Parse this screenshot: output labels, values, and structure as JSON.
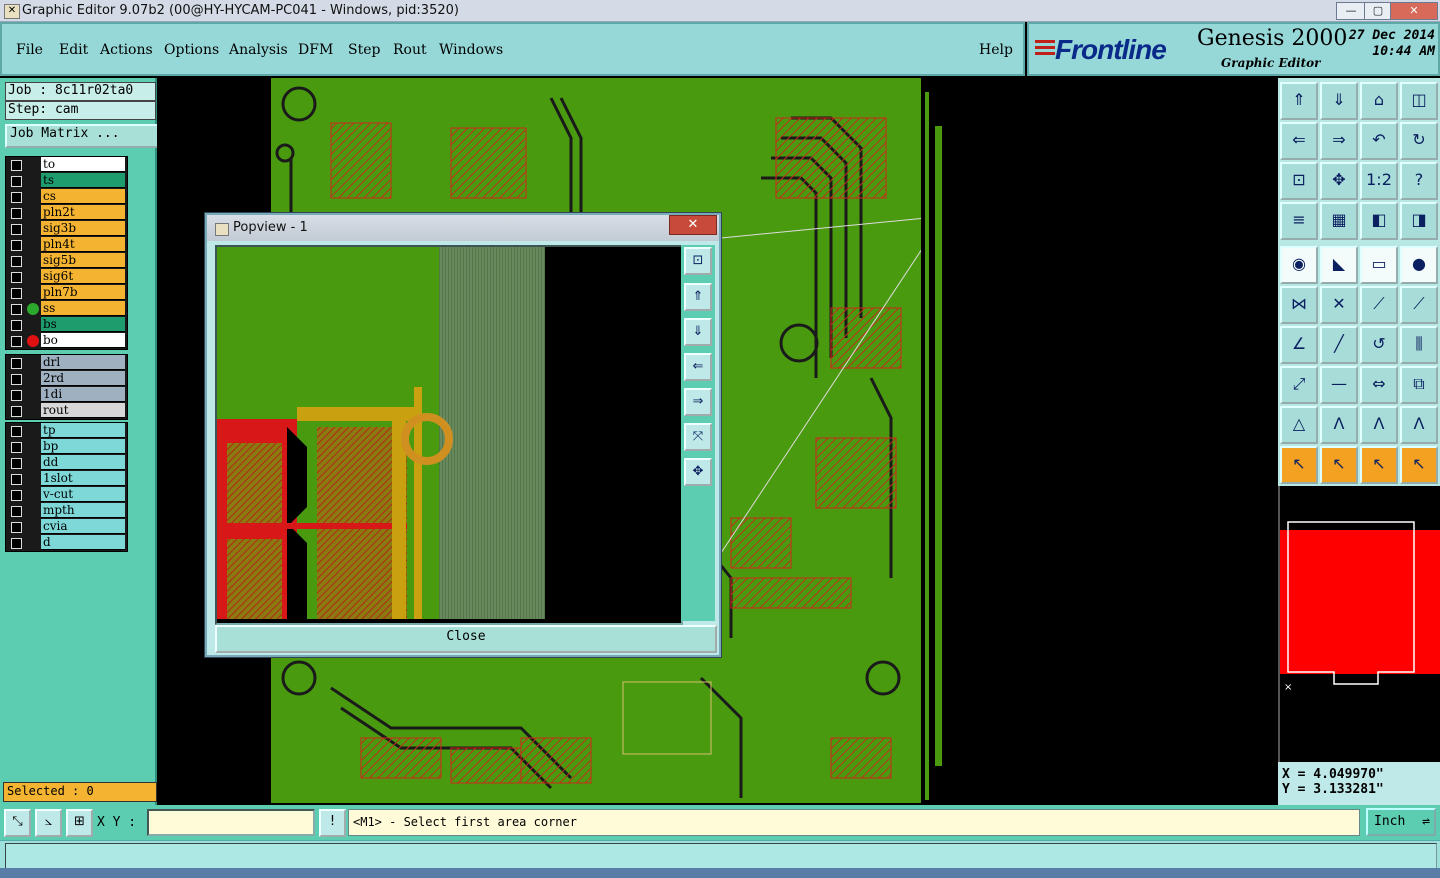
{
  "window": {
    "title": "Graphic Editor 9.07b2 (00@HY-HYCAM-PC041 - Windows, pid:3520)",
    "controls": [
      "—",
      "▢",
      "✕"
    ]
  },
  "menu": {
    "items": [
      "File",
      "Edit",
      "Actions",
      "Options",
      "Analysis",
      "DFM",
      "Step",
      "Rout",
      "Windows"
    ],
    "help": "Help"
  },
  "logo": {
    "brand": "Frontline",
    "product": "Genesis 2000",
    "subtitle": "Graphic Editor",
    "date": "27 Dec 2014",
    "time": "10:44 AM"
  },
  "left_panel": {
    "job": "Job : 8c11r02ta0",
    "step": "Step: cam",
    "job_matrix": "Job Matrix ...",
    "board_layers": [
      {
        "name": "to",
        "color": "#ffffff",
        "dot": ""
      },
      {
        "name": "ts",
        "color": "#1e9c6e",
        "dot": ""
      },
      {
        "name": "cs",
        "color": "#f4b432",
        "dot": ""
      },
      {
        "name": "pln2t",
        "color": "#f4b432",
        "dot": ""
      },
      {
        "name": "sig3b",
        "color": "#f4b432",
        "dot": ""
      },
      {
        "name": "pln4t",
        "color": "#f4b432",
        "dot": ""
      },
      {
        "name": "sig5b",
        "color": "#f4b432",
        "dot": ""
      },
      {
        "name": "sig6t",
        "color": "#f4b432",
        "dot": ""
      },
      {
        "name": "pln7b",
        "color": "#f4b432",
        "dot": ""
      },
      {
        "name": "ss",
        "color": "#f4b432",
        "dot": "#2ca82c"
      },
      {
        "name": "bs",
        "color": "#1e9c6e",
        "dot": ""
      },
      {
        "name": "bo",
        "color": "#ffffff",
        "dot": "#e01010"
      }
    ],
    "drill_layers": [
      {
        "name": "drl",
        "color": "#9fb0c0"
      },
      {
        "name": "2rd",
        "color": "#9fb0c0"
      },
      {
        "name": "1di",
        "color": "#9fb0c0"
      },
      {
        "name": "rout",
        "color": "#d8d8d8"
      }
    ],
    "misc_layers": [
      {
        "name": "tp",
        "color": "#7fd8d8"
      },
      {
        "name": "bp",
        "color": "#7fd8d8"
      },
      {
        "name": "dd",
        "color": "#7fd8d8"
      },
      {
        "name": "1slot",
        "color": "#7fd8d8"
      },
      {
        "name": "v-cut",
        "color": "#7fd8d8"
      },
      {
        "name": "mpth",
        "color": "#7fd8d8"
      },
      {
        "name": "cvia",
        "color": "#7fd8d8"
      },
      {
        "name": "d",
        "color": "#7fd8d8"
      }
    ],
    "selected": "Selected : 0"
  },
  "popview": {
    "title": "Popview - 1",
    "close_label": "Close",
    "close_x": "✕",
    "tools": [
      "zoom-fit-icon",
      "pan-up-icon",
      "pan-down-icon",
      "pan-left-icon",
      "pan-right-icon",
      "zoom-extents-icon",
      "center-icon"
    ]
  },
  "right_tools": {
    "rows": [
      [
        "pan-up-icon",
        "pan-down-icon",
        "home-icon",
        "split-view-icon"
      ],
      [
        "pan-left-icon",
        "pan-right-icon",
        "zoom-back-icon",
        "redraw-icon"
      ],
      [
        "zoom-fit-icon",
        "zoom-center-icon",
        "one-to-two-icon",
        "help-icon"
      ],
      [
        "layer-settings-icon",
        "grid-icon",
        "display-toggle-icon",
        "display-toggle-2-icon"
      ],
      [
        "select-pad-icon",
        "line-tool-icon",
        "measure-icon",
        "feature-icon"
      ],
      [
        "snap-node-icon",
        "cross-icon",
        "connect-icon",
        "connect-2-icon"
      ],
      [
        "angle-icon",
        "diagonal-icon",
        "rotate-icon",
        "mirror-icon"
      ],
      [
        "move-node-icon",
        "cut-line-icon",
        "resize-icon",
        "group-icon"
      ],
      [
        "triangle-icon",
        "peak-icon",
        "peak-up-icon",
        "peak-down-icon"
      ],
      [
        "pointer-icon",
        "pointer-box-icon",
        "pointer-circle-icon",
        "pointer-multi-icon"
      ]
    ],
    "one_to_two_label": "1:2",
    "help_label": "?"
  },
  "coords": {
    "x": "X = 4.049970\"",
    "y": "Y = 3.133281\""
  },
  "bottom": {
    "xy_label": "X Y :",
    "xy_value": "",
    "alert": "!",
    "prompt": "<M1> - Select first area corner",
    "units": "Inch"
  }
}
